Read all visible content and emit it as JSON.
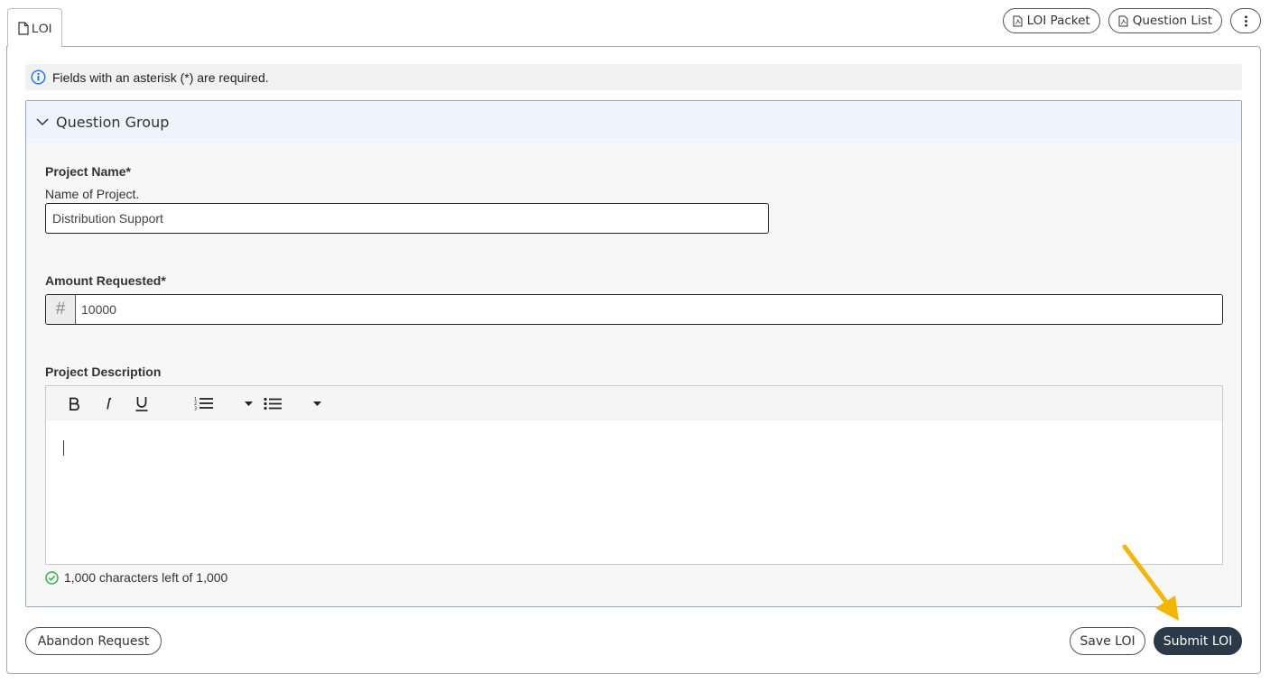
{
  "tab": {
    "label": "LOI",
    "icon": "document-icon"
  },
  "actions": {
    "loi_packet": "LOI Packet",
    "question_list": "Question List",
    "pdf_icon": "pdf-file-icon",
    "more_icon": "more-vertical-icon"
  },
  "info": {
    "text": "Fields with an asterisk (*) are required.",
    "icon": "info-icon"
  },
  "group": {
    "title": "Question Group",
    "icon": "chevron-down-icon",
    "colors": {
      "header": "#eef4fc",
      "border": "#9aa7b4"
    }
  },
  "fields": {
    "project_name": {
      "label": "Project Name*",
      "help": "Name of Project.",
      "value": "Distribution Support"
    },
    "amount": {
      "label": "Amount Requested*",
      "prefix": "#",
      "value": "10000"
    },
    "description": {
      "label": "Project Description",
      "toolbar": [
        "bold",
        "italic",
        "underline",
        "numbered-list",
        "dropdown",
        "bulleted-list",
        "dropdown"
      ],
      "char_count": "1,000 characters left of 1,000"
    }
  },
  "buttons": {
    "abandon": "Abandon Request",
    "save": "Save LOI",
    "submit": "Submit LOI"
  },
  "colors": {
    "primary_button": "#2b3a49",
    "success": "#2db34a",
    "info": "#1a73e8",
    "annotation_arrow": "#f2b705"
  }
}
